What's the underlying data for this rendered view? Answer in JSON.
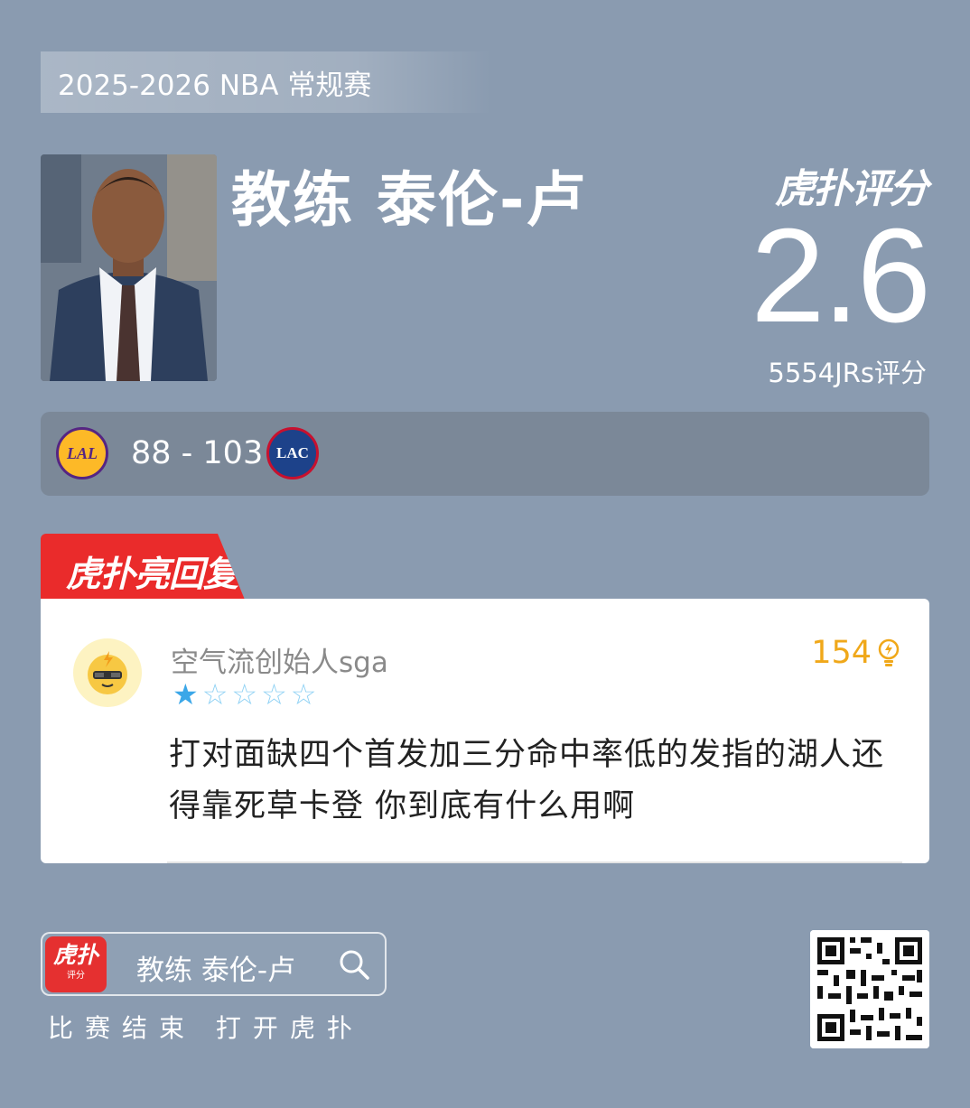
{
  "header": {
    "season": "2025-2026 NBA 常规赛",
    "title": "教练 泰伦-卢",
    "brand_logo": "虎扑评分"
  },
  "rating": {
    "score": "2.6",
    "count_label": "5554JRs评分"
  },
  "game": {
    "home_team_logo_text": "LAL",
    "away_team_logo_text": "LAC",
    "score": "88 - 103",
    "colors": {
      "lal_gold": "#fdb927",
      "lal_purple": "#552583",
      "lac_blue": "#1d428a",
      "lac_red": "#c8102e"
    }
  },
  "hot_reply": {
    "tag_label": "虎扑亮回复",
    "username": "空气流创始人sga",
    "likes": "154",
    "rating_stars": 1,
    "rating_max": 5,
    "comment": "打对面缺四个首发加三分命中率低的发指的湖人还得靠死草卡登 你到底有什么用啊"
  },
  "footer": {
    "app_icon_big": "虎扑",
    "app_icon_small": "评分",
    "search_text": "教练 泰伦-卢",
    "caption": "比赛结束 打开虎扑"
  },
  "icons": {
    "search": "search-icon",
    "like": "lightbulb-icon",
    "qr": "qr-code-icon",
    "avatar": "cool-helmet-avatar-icon"
  },
  "colors": {
    "background": "#8a9bb0",
    "accent_red": "#ea2b2b",
    "likes_orange": "#f0a81a",
    "star_blue": "#3ba7e8"
  }
}
